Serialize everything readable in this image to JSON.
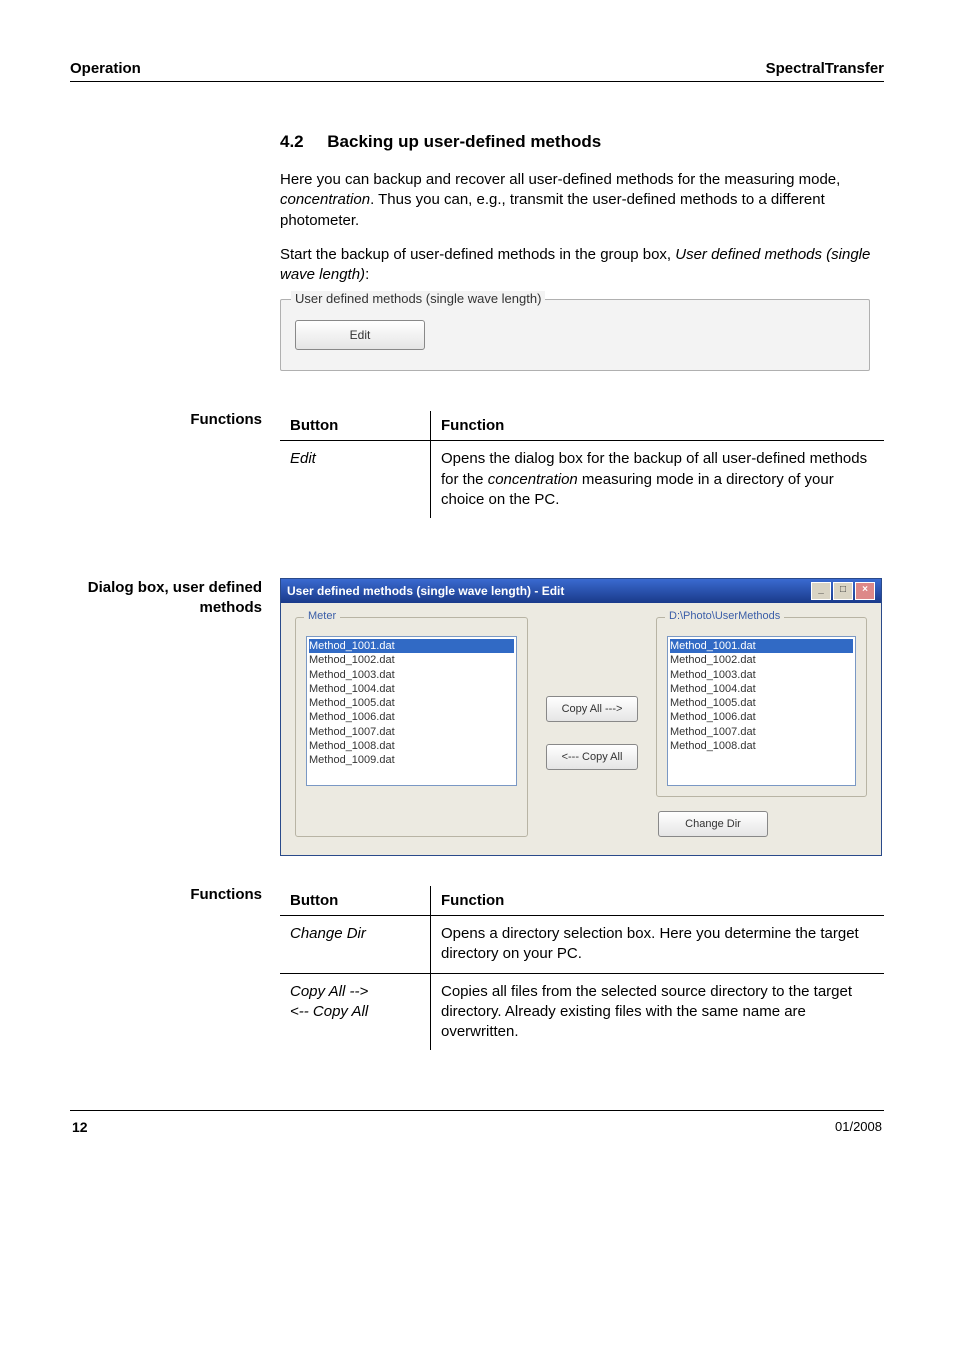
{
  "header": {
    "left": "Operation",
    "right": "SpectralTransfer"
  },
  "section": {
    "number": "4.2",
    "title": "Backing up user-defined methods"
  },
  "intro": {
    "p1a": "Here you can backup and recover all user-defined methods for the measuring mode, ",
    "p1b": "concentration",
    "p1c": ". Thus you can, e.g., transmit the user-defined methods to a different photometer.",
    "p2a": "Start the backup of user-defined methods in the group box, ",
    "p2b": "User defined methods (single wave length)",
    "p2c": ":"
  },
  "groupbox": {
    "legend": "User defined methods (single wave length)",
    "edit_label": "Edit"
  },
  "labels": {
    "functions": "Functions",
    "dialog_box": "Dialog box, user defined methods"
  },
  "table1": {
    "col_button": "Button",
    "col_function": "Function",
    "row_button": "Edit",
    "row_func_a": "Opens the dialog box for the backup of all user-defined methods for the ",
    "row_func_b": "concentration",
    "row_func_c": " measuring mode in a directory of your choice on the PC."
  },
  "dialog": {
    "title": "User defined methods (single wave length) - Edit",
    "meter_legend": "Meter",
    "path_legend": "D:\\Photo\\UserMethods",
    "meter_items": [
      "Method_1001.dat",
      "Method_1002.dat",
      "Method_1003.dat",
      "Method_1004.dat",
      "Method_1005.dat",
      "Method_1006.dat",
      "Method_1007.dat",
      "Method_1008.dat",
      "Method_1009.dat"
    ],
    "dir_items": [
      "Method_1001.dat",
      "Method_1002.dat",
      "Method_1003.dat",
      "Method_1004.dat",
      "Method_1005.dat",
      "Method_1006.dat",
      "Method_1007.dat",
      "Method_1008.dat"
    ],
    "copy_right": "Copy All --->",
    "copy_left": "<--- Copy All",
    "change_dir": "Change Dir"
  },
  "table2": {
    "col_button": "Button",
    "col_function": "Function",
    "r1_button": "Change Dir",
    "r1_func": "Opens a directory selection box. Here you determine the target directory on your PC.",
    "r2_button_a": "Copy All -->",
    "r2_button_b": "<-- Copy All",
    "r2_func": "Copies all files from the selected source directory to the target directory. Already existing files with the same name are overwritten."
  },
  "footer": {
    "page": "12",
    "date": "01/2008"
  }
}
